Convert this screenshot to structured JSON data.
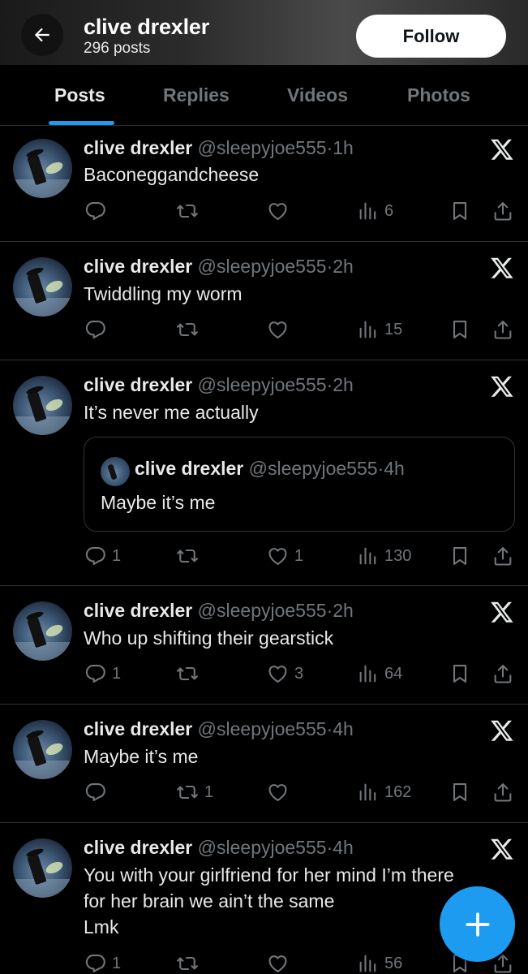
{
  "header": {
    "name": "clive drexler",
    "post_count": "296 posts",
    "follow_label": "Follow"
  },
  "tabs": [
    {
      "label": "Posts",
      "active": true
    },
    {
      "label": "Replies",
      "active": false
    },
    {
      "label": "Videos",
      "active": false
    },
    {
      "label": "Photos",
      "active": false
    }
  ],
  "posts": [
    {
      "name": "clive drexler",
      "handle": "@sleepyjoe555",
      "time": "1h",
      "text": "Baconeggandcheese",
      "replies": "",
      "reposts": "",
      "likes": "",
      "views": "6"
    },
    {
      "name": "clive drexler",
      "handle": "@sleepyjoe555",
      "time": "2h",
      "text": "Twiddling my worm",
      "replies": "",
      "reposts": "",
      "likes": "",
      "views": "15"
    },
    {
      "name": "clive drexler",
      "handle": "@sleepyjoe555",
      "time": "2h",
      "text": "It’s never me actually",
      "quote": {
        "name": "clive drexler",
        "handle": "@sleepyjoe555",
        "time": "4h",
        "text": "Maybe it’s me"
      },
      "replies": "1",
      "reposts": "",
      "likes": "1",
      "views": "130"
    },
    {
      "name": "clive drexler",
      "handle": "@sleepyjoe555",
      "time": "2h",
      "text": "Who up shifting their gearstick",
      "replies": "1",
      "reposts": "",
      "likes": "3",
      "views": "64"
    },
    {
      "name": "clive drexler",
      "handle": "@sleepyjoe555",
      "time": "4h",
      "text": "Maybe it’s me",
      "replies": "",
      "reposts": "1",
      "likes": "",
      "views": "162"
    },
    {
      "name": "clive drexler",
      "handle": "@sleepyjoe555",
      "time": "4h",
      "text_lines": [
        "You with your girlfriend for her mind I’m there",
        "for her brain we ain’t the same",
        "Lmk"
      ],
      "replies": "1",
      "reposts": "",
      "likes": "",
      "views": "56"
    }
  ],
  "separator": "·",
  "icons": {
    "back": "arrow-left-icon",
    "source": "x-logo-icon",
    "reply": "reply-icon",
    "repost": "repost-icon",
    "like": "heart-icon",
    "views": "views-icon",
    "bookmark": "bookmark-icon",
    "share": "share-icon",
    "compose": "plus-icon"
  },
  "colors": {
    "accent": "#1d9bf0",
    "muted": "#71767b",
    "text": "#e7e9ea",
    "divider": "#2f3336"
  }
}
